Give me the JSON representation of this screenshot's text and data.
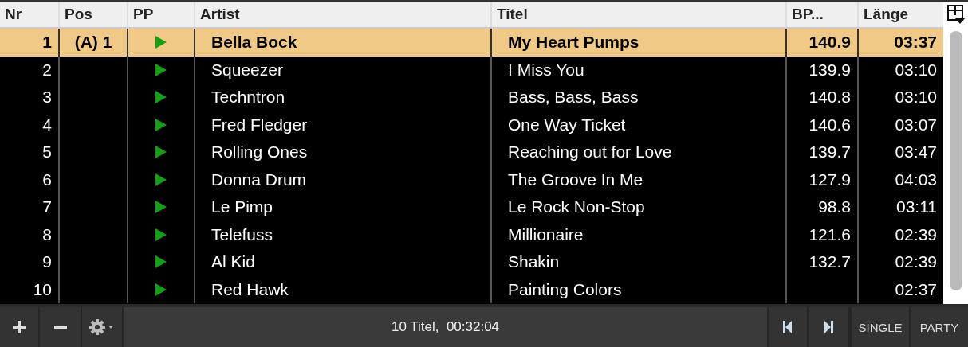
{
  "table": {
    "columns": [
      "Nr",
      "Pos",
      "PP",
      "Artist",
      "Titel",
      "BP...",
      "Länge"
    ],
    "rows": [
      {
        "nr": "1",
        "pos": "(A) 1",
        "artist": "Bella Bock",
        "title": "My Heart Pumps",
        "bpm": "140.9",
        "length": "03:37",
        "selected": true
      },
      {
        "nr": "2",
        "artist": "Squeezer",
        "title": "I Miss You",
        "bpm": "139.9",
        "length": "03:10",
        "selected": false
      },
      {
        "nr": "3",
        "artist": "Techntron",
        "title": "Bass, Bass, Bass",
        "bpm": "140.8",
        "length": "03:10",
        "selected": false
      },
      {
        "nr": "4",
        "artist": "Fred Fledger",
        "title": "One Way Ticket",
        "bpm": "140.6",
        "length": "03:07",
        "selected": false
      },
      {
        "nr": "5",
        "artist": "Rolling Ones",
        "title": "Reaching out for Love",
        "bpm": "139.7",
        "length": "03:47",
        "selected": false
      },
      {
        "nr": "6",
        "artist": "Donna Drum",
        "title": "The Groove In Me",
        "bpm": "127.9",
        "length": "04:03",
        "selected": false
      },
      {
        "nr": "7",
        "artist": "Le Pimp",
        "title": "Le Rock Non-Stop",
        "bpm": "98.8",
        "length": "03:11",
        "selected": false
      },
      {
        "nr": "8",
        "artist": "Telefuss",
        "title": "Millionaire",
        "bpm": "121.6",
        "length": "02:39",
        "selected": false
      },
      {
        "nr": "9",
        "artist": "Al Kid",
        "title": "Shakin",
        "bpm": "132.7",
        "length": "02:39",
        "selected": false
      },
      {
        "nr": "10",
        "artist": "Red Hawk",
        "title": "Painting Colors",
        "length": "02:37",
        "selected": false
      }
    ]
  },
  "status_bar": {
    "summary": "10 Titel,  00:32:04",
    "modes": [
      "SINGLE",
      "PARTY"
    ]
  }
}
